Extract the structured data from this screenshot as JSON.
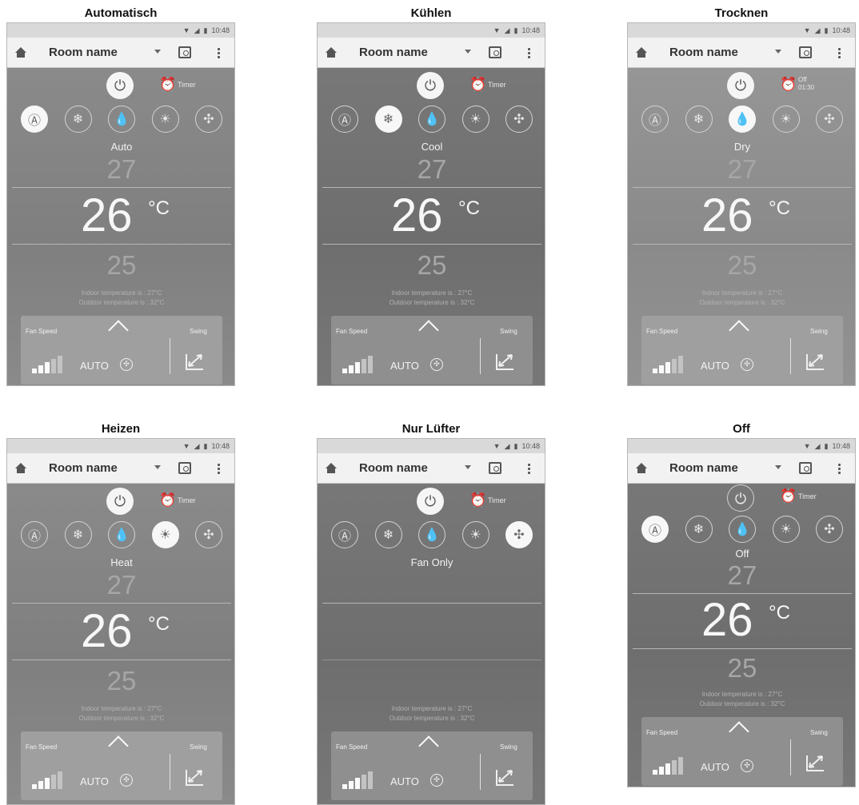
{
  "status": {
    "time": "10:48"
  },
  "app": {
    "room_name": "Room name",
    "timer_label": "Timer",
    "fan_speed_label": "Fan Speed",
    "swing_label": "Swing",
    "fan_mode": "AUTO",
    "temp_high": "27",
    "temp_current": "26",
    "temp_unit": "°C",
    "temp_low": "25",
    "indoor_text": "Indoor temperature is : 27°C",
    "outdoor_text": "Outdoor temperature is : 32°C"
  },
  "panels": [
    {
      "caption": "Automatisch",
      "mode_label": "Auto"
    },
    {
      "caption": "Kühlen",
      "mode_label": "Cool"
    },
    {
      "caption": "Trocknen",
      "mode_label": "Dry",
      "timer_line1": "Off",
      "timer_line2": "01:30"
    },
    {
      "caption": "Heizen",
      "mode_label": "Heat"
    },
    {
      "caption": "Nur Lüfter",
      "mode_label": "Fan Only"
    },
    {
      "caption": "Off",
      "mode_label": "Off"
    }
  ],
  "icons": {
    "modes": [
      "auto-mode-icon",
      "cool-mode-icon",
      "dry-mode-icon",
      "heat-mode-icon",
      "fan-mode-icon"
    ],
    "power": "power-icon",
    "timer": "alarm-clock-icon"
  },
  "fan_speed_level": 0.6
}
